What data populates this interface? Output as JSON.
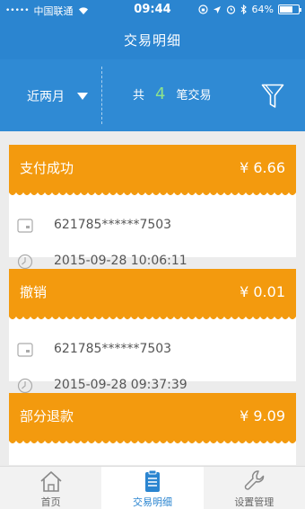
{
  "status_bar": {
    "signal": "•••••",
    "carrier": "中国联通",
    "time": "09:44",
    "battery": "64%",
    "battery_level": 0.64
  },
  "header": {
    "title": "交易明细"
  },
  "filter": {
    "period": "近两月",
    "count_prefix": "共",
    "count": "4",
    "count_suffix": "笔交易"
  },
  "transactions": [
    {
      "status": "支付成功",
      "amount": "¥ 6.66",
      "card": "621785******7503",
      "time": "2015-09-28 10:06:11"
    },
    {
      "status": "撤销",
      "amount": "¥ 0.01",
      "card": "621785******7503",
      "time": "2015-09-28 09:37:39"
    },
    {
      "status": "部分退款",
      "amount": "¥ 9.09",
      "card": "",
      "time": ""
    }
  ],
  "tabs": [
    {
      "label": "首页",
      "icon": "home-icon"
    },
    {
      "label": "交易明细",
      "icon": "clipboard-icon"
    },
    {
      "label": "设置管理",
      "icon": "wrench-icon"
    }
  ],
  "colors": {
    "header_blue": "#2b85d0",
    "card_orange": "#f39a0e",
    "count_green": "#8ee38b"
  }
}
